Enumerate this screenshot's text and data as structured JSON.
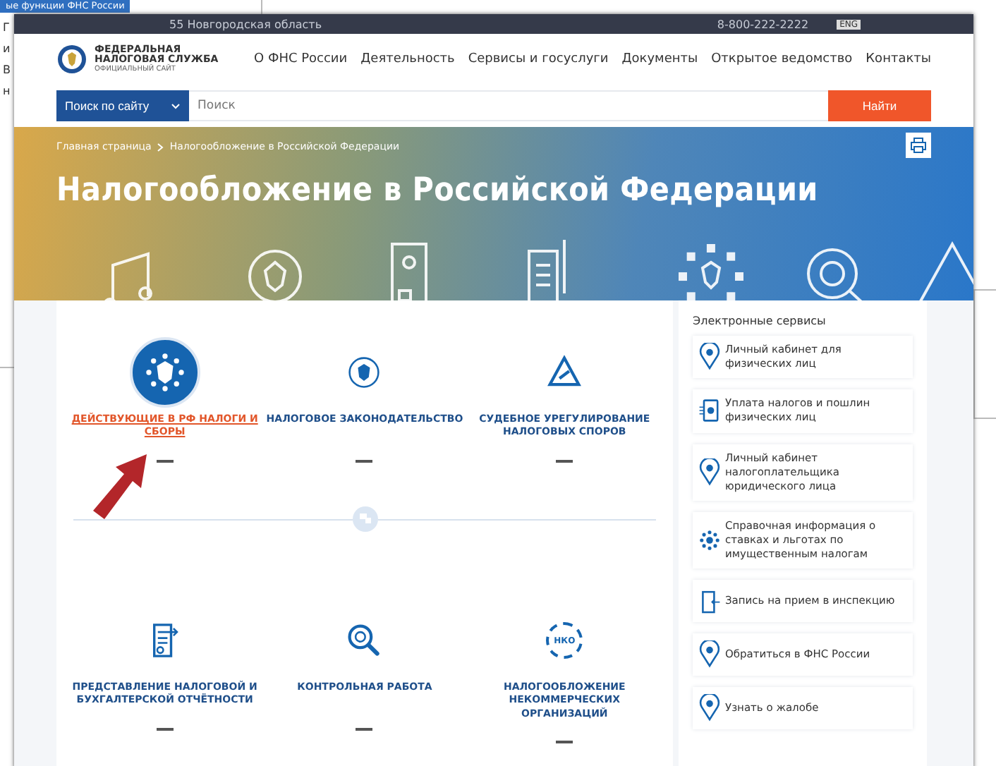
{
  "background_window": {
    "title": "ые функции ФНС России",
    "fragments": [
      "Г",
      "и",
      "В",
      "н"
    ]
  },
  "top_bar": {
    "region": "55 Новгородская область",
    "phone": "8-800-222-2222",
    "language": "ENG"
  },
  "logo": {
    "line1": "ФЕДЕРАЛЬНАЯ",
    "line2": "НАЛОГОВАЯ СЛУЖБА",
    "line3": "ОФИЦИАЛЬНЫЙ САЙТ"
  },
  "nav": [
    "О ФНС России",
    "Деятельность",
    "Сервисы и госуслуги",
    "Документы",
    "Открытое ведомство",
    "Контакты"
  ],
  "search": {
    "scope": "Поиск по сайту",
    "placeholder": "Поиск",
    "button": "Найти"
  },
  "breadcrumbs": [
    "Главная страница",
    "Налогообложение в Российской Федерации"
  ],
  "page_title": "Налогообложение в Российской Федерации",
  "categories": [
    {
      "label": "ДЕЙСТВУЮЩИЕ В РФ НАЛОГИ И СБОРЫ",
      "kind": "emblem",
      "selected": true
    },
    {
      "label": "НАЛОГОВОЕ ЗАКОНОДАТЕЛЬСТВО",
      "kind": "emblem",
      "selected": false
    },
    {
      "label": "СУДЕБНОЕ УРЕГУЛИРОВАНИЕ НАЛОГОВЫХ СПОРОВ",
      "kind": "court",
      "selected": false
    },
    {
      "label": "ПРЕДСТАВЛЕНИЕ НАЛОГОВОЙ И БУХГАЛТЕРСКОЙ ОТЧЁТНОСТИ",
      "kind": "report",
      "selected": false
    },
    {
      "label": "КОНТРОЛЬНАЯ РАБОТА",
      "kind": "inspect",
      "selected": false
    },
    {
      "label": "НАЛОГООБЛОЖЕНИЕ НЕКОММЕРЧЕСКИХ ОРГАНИЗАЦИЙ",
      "kind": "nko",
      "selected": false
    }
  ],
  "nko_badge": "НКО",
  "services": {
    "title": "Электронные сервисы",
    "items": [
      {
        "label": "Личный кабинет для физических лиц",
        "kind": "pin"
      },
      {
        "label": "Уплата налогов и пошлин физических лиц",
        "kind": "pay"
      },
      {
        "label": "Личный кабинет налогоплательщика юридического лица",
        "kind": "pin"
      },
      {
        "label": "Справочная информация о ставках и льготах по имущественным налогам",
        "kind": "dots"
      },
      {
        "label": "Запись на прием в инспекцию",
        "kind": "door"
      },
      {
        "label": "Обратиться в ФНС России",
        "kind": "pin"
      },
      {
        "label": "Узнать о жалобе",
        "kind": "pin"
      }
    ]
  }
}
